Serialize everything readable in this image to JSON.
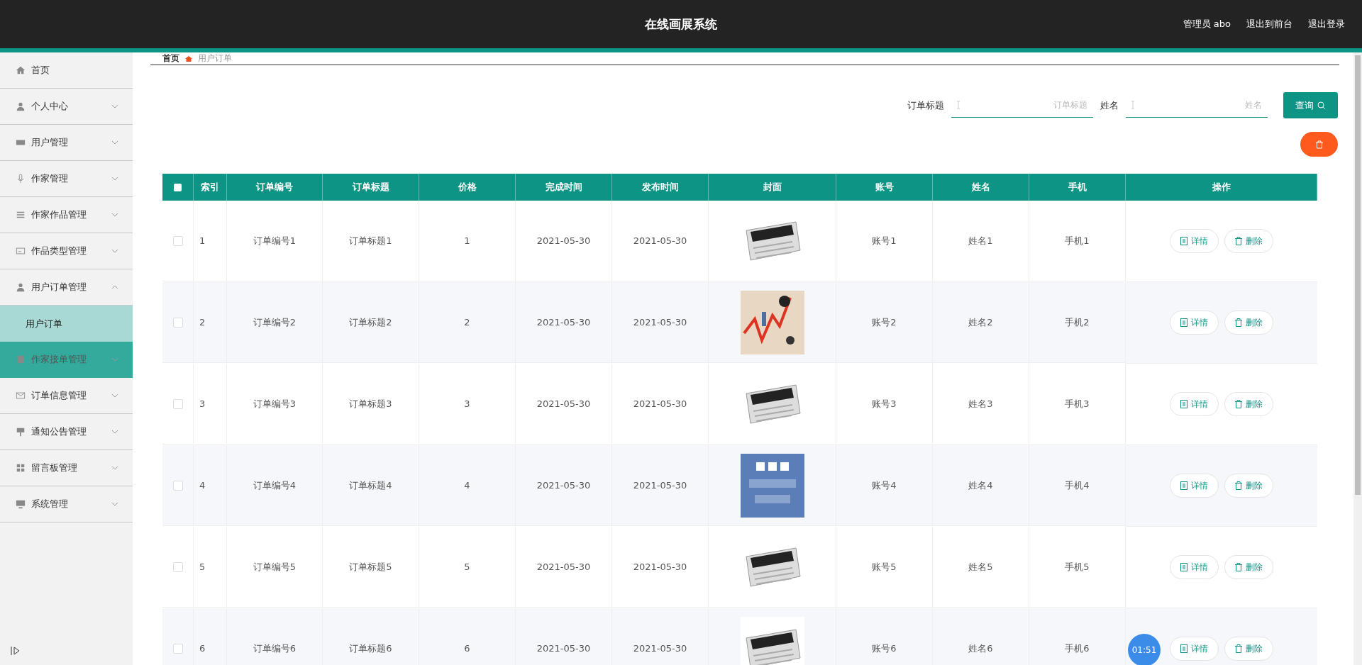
{
  "header": {
    "title": "在线画展系统",
    "user": "管理员 abo",
    "links": [
      "退出到前台",
      "退出登录"
    ]
  },
  "sidebar": {
    "items": [
      {
        "label": "首页",
        "highlighted": false
      },
      {
        "label": "个人中心",
        "expanded": false,
        "highlighted": false
      },
      {
        "label": "用户管理",
        "expanded": false,
        "highlighted": false
      },
      {
        "label": "作家管理",
        "expanded": false,
        "highlighted": false
      },
      {
        "label": "作家作品管理",
        "expanded": false,
        "highlighted": false
      },
      {
        "label": "作品类型管理",
        "expanded": false,
        "highlighted": false
      },
      {
        "label": "用户订单管理",
        "expanded": true,
        "highlighted": false,
        "children": [
          {
            "label": "用户订单",
            "selected": true
          }
        ]
      },
      {
        "label": "作家接单管理",
        "expanded": false,
        "highlighted": true
      },
      {
        "label": "订单信息管理",
        "expanded": false,
        "highlighted": false
      },
      {
        "label": "通知公告管理",
        "expanded": false,
        "highlighted": false
      },
      {
        "label": "留言板管理",
        "expanded": false,
        "highlighted": false
      },
      {
        "label": "系统管理",
        "expanded": false,
        "highlighted": false
      }
    ]
  },
  "breadcrumb": [
    "首页",
    "用户订单"
  ],
  "search": {
    "fields": [
      {
        "label": "订单标题",
        "placeholder": "订单标题"
      },
      {
        "label": "姓名",
        "placeholder": "姓名"
      }
    ],
    "button": "查询"
  },
  "table": {
    "columns": [
      "索引",
      "订单编号",
      "订单标题",
      "价格",
      "完成时间",
      "发布时间",
      "封面",
      "账号",
      "姓名",
      "手机",
      "操作"
    ],
    "header_checked": false,
    "rows": [
      {
        "checked": false,
        "cells": [
          "1",
          "订单编号1",
          "订单标题1",
          "1",
          "2021-05-30",
          "2021-05-30",
          {
            "kind": "picture"
          },
          "账号1",
          "姓名1",
          "手机1"
        ],
        "actions": [
          "详情",
          "删除"
        ]
      },
      {
        "checked": false,
        "cells": [
          "2",
          "订单编号2",
          "订单标题2",
          "2",
          "2021-05-30",
          "2021-05-30",
          {
            "kind": "picture"
          },
          "账号2",
          "姓名2",
          "手机2"
        ],
        "actions": [
          "详情",
          "删除"
        ]
      },
      {
        "checked": false,
        "cells": [
          "3",
          "订单编号3",
          "订单标题3",
          "3",
          "2021-05-30",
          "2021-05-30",
          {
            "kind": "picture"
          },
          "账号3",
          "姓名3",
          "手机3"
        ],
        "actions": [
          "详情",
          "删除"
        ]
      },
      {
        "checked": false,
        "cells": [
          "4",
          "订单编号4",
          "订单标题4",
          "4",
          "2021-05-30",
          "2021-05-30",
          {
            "kind": "picture"
          },
          "账号4",
          "姓名4",
          "手机4"
        ],
        "actions": [
          "详情",
          "删除"
        ]
      },
      {
        "checked": false,
        "cells": [
          "5",
          "订单编号5",
          "订单标题5",
          "5",
          "2021-05-30",
          "2021-05-30",
          {
            "kind": "picture"
          },
          "账号5",
          "姓名5",
          "手机5"
        ],
        "actions": [
          "详情",
          "删除"
        ]
      },
      {
        "checked": false,
        "cells": [
          "6",
          "订单编号6",
          "订单标题6",
          "6",
          "2021-05-30",
          "2021-05-30",
          {
            "kind": "picture"
          },
          "账号6",
          "姓名6",
          "手机6"
        ],
        "actions": [
          "详情",
          "删除"
        ]
      }
    ]
  },
  "timer_badge": "01:51"
}
